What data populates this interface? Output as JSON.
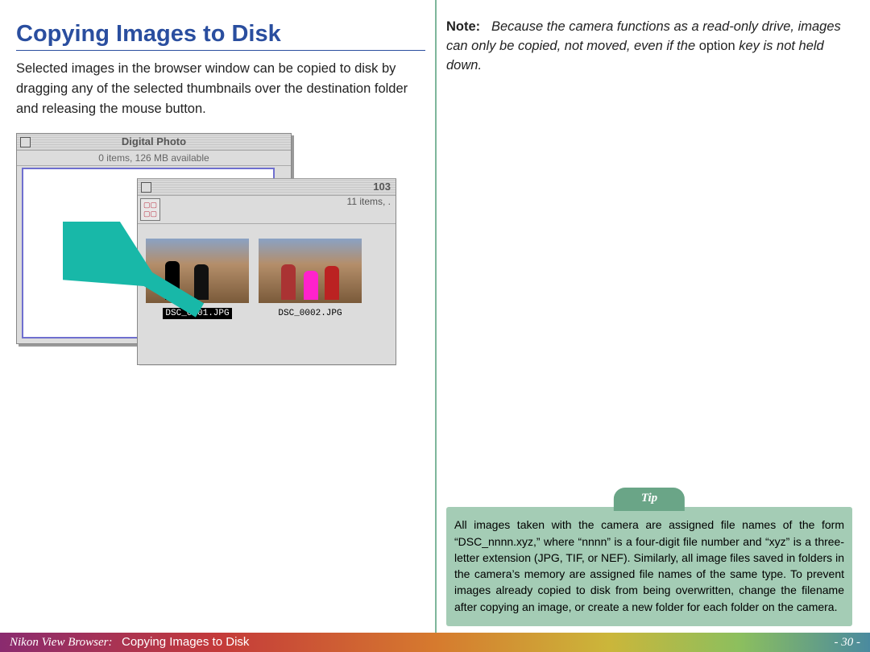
{
  "title": "Copying Images to Disk",
  "body": "Selected images in the browser window can be copied to disk by dragging any of the selected thumbnails over the destination folder and releasing the mouse button.",
  "note": {
    "label": "Note:",
    "text_part1": "Because the camera functions as a read-only drive, images can only be copied, not moved, even if the ",
    "option_word": "option",
    "text_part2": " key is not held down."
  },
  "mock": {
    "win1_title": "Digital Photo",
    "win1_status": "0 items, 126 MB available",
    "win2_title": "103",
    "win2_status": "11 items, .",
    "thumb1_name": "DSC_0001.JPG",
    "thumb2_name": "DSC_0002.JPG"
  },
  "tip": {
    "label": "Tip",
    "body": "All images taken with the camera are assigned file names of the form “DSC_nnnn.xyz,” where “nnnn” is a four-digit file number and “xyz” is a three-letter extension (JPG, TIF, or NEF).  Similarly, all image files saved in folders in the camera’s memory are assigned file names of the same type.  To prevent images already copied to disk from being overwritten, change the filename after copying an image, or create a new folder for each folder on the camera."
  },
  "footer": {
    "app": "Nikon View Browser",
    "section": "Copying Images to Disk",
    "page": "- 30 -"
  }
}
